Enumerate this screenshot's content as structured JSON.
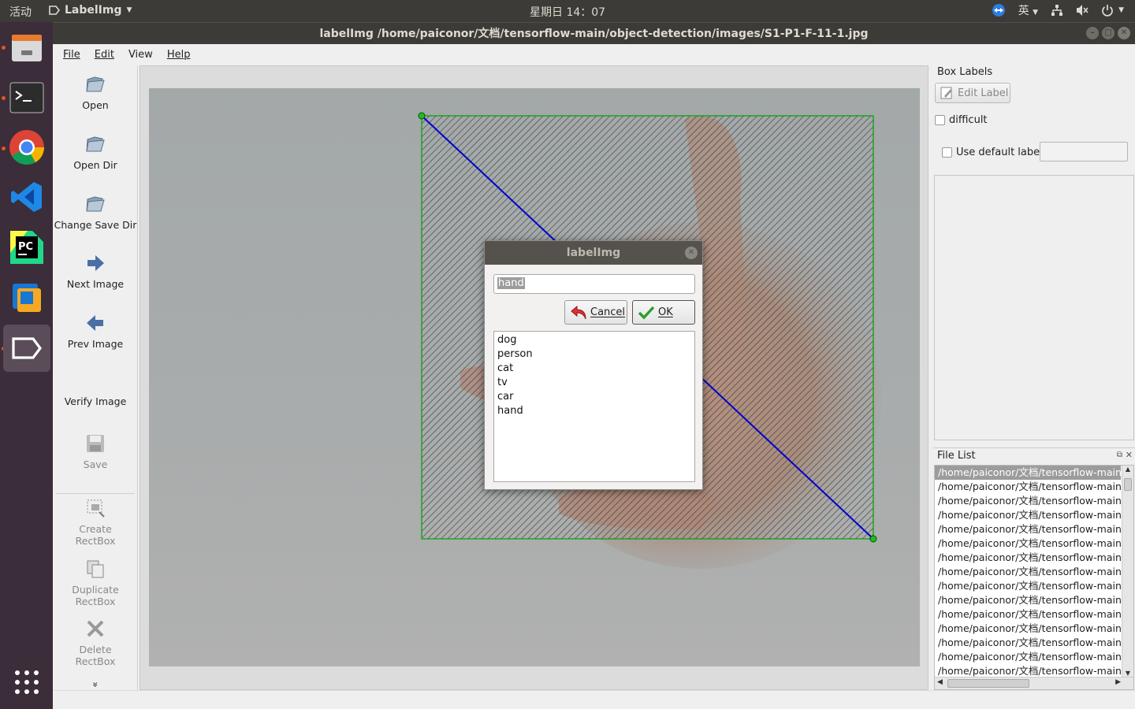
{
  "topbar": {
    "activities": "活动",
    "app_name": "LabelImg",
    "clock": "星期日 14：07",
    "input_method": "英"
  },
  "window": {
    "title": "labelImg /home/paiconor/文档/tensorflow-main/object-detection/images/S1-P1-F-11-1.jpg"
  },
  "menu": {
    "file": "File",
    "edit": "Edit",
    "view": "View",
    "help": "Help"
  },
  "toolbar": {
    "open": "Open",
    "open_dir": "Open Dir",
    "change_save_dir": "Change Save Dir",
    "next_image": "Next Image",
    "prev_image": "Prev Image",
    "verify_image": "Verify Image",
    "save": "Save",
    "create_rectbox_1": "Create",
    "create_rectbox_2": "RectBox",
    "duplicate_rectbox_1": "Duplicate",
    "duplicate_rectbox_2": "RectBox",
    "delete_rectbox_1": "Delete",
    "delete_rectbox_2": "RectBox",
    "more": "»"
  },
  "right_panel": {
    "box_labels_title": "Box Labels",
    "edit_label": "Edit Label",
    "difficult": "difficult",
    "use_default_label": "Use default label",
    "default_label_value": "",
    "file_list_title": "File List",
    "files": [
      "/home/paiconor/文档/tensorflow-main/ob",
      "/home/paiconor/文档/tensorflow-main/ob",
      "/home/paiconor/文档/tensorflow-main/ob",
      "/home/paiconor/文档/tensorflow-main/ob",
      "/home/paiconor/文档/tensorflow-main/ob",
      "/home/paiconor/文档/tensorflow-main/ob",
      "/home/paiconor/文档/tensorflow-main/ob",
      "/home/paiconor/文档/tensorflow-main/ob",
      "/home/paiconor/文档/tensorflow-main/ob",
      "/home/paiconor/文档/tensorflow-main/ob",
      "/home/paiconor/文档/tensorflow-main/ob",
      "/home/paiconor/文档/tensorflow-main/ob",
      "/home/paiconor/文档/tensorflow-main/ob",
      "/home/paiconor/文档/tensorflow-main/ob",
      "/home/paiconor/文档/tensorflow-main/ob"
    ]
  },
  "dialog": {
    "title": "labelImg",
    "input_value": "hand",
    "cancel": "Cancel",
    "ok": "OK",
    "labels": [
      "dog",
      "person",
      "cat",
      "tv",
      "car",
      "hand"
    ]
  },
  "colors": {
    "box_outline": "#00a000",
    "diagonal": "#0000cc",
    "dock_bg": "#3b2d39",
    "accent": "#e95420"
  }
}
